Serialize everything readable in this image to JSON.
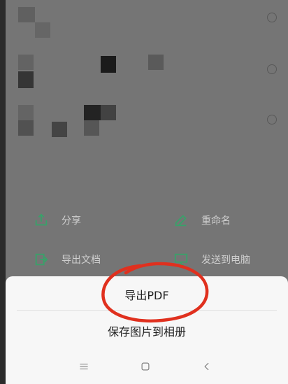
{
  "action_grid": {
    "share_label": "分享",
    "rename_label": "重命名",
    "export_doc_label": "导出文档",
    "send_to_pc_label": "发送到电脑"
  },
  "bottom_sheet": {
    "export_pdf_label": "导出PDF",
    "save_image_label": "保存图片到相册"
  },
  "navbar": {
    "menu_icon": "menu-icon",
    "home_icon": "home-icon",
    "back_icon": "back-icon"
  },
  "colors": {
    "accent_icon": "#2e8b57",
    "annotation": "#e0301e",
    "sheet_bg": "#f7f7f7"
  }
}
